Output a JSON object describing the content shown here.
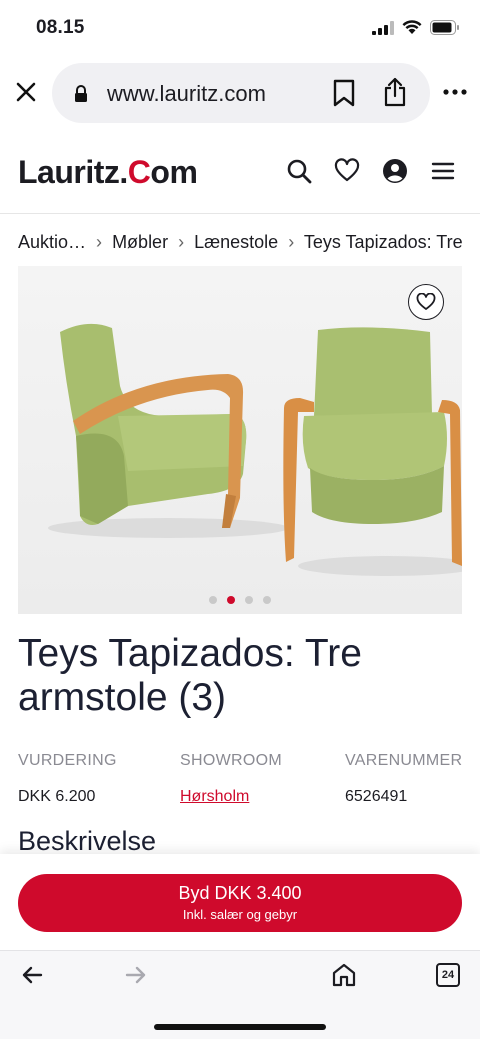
{
  "status": {
    "time": "08.15"
  },
  "browser": {
    "url": "www.lauritz.com",
    "icons": [
      "close-icon",
      "lock-icon",
      "bookmark-icon",
      "share-icon",
      "more-icon"
    ]
  },
  "header": {
    "logo_left": "Lauritz.",
    "logo_right": "om",
    "icons": [
      "search-icon",
      "heart-icon",
      "account-icon",
      "menu-icon"
    ]
  },
  "breadcrumb": [
    "Auktio…",
    "Møbler",
    "Lænestole",
    "Teys Tapizados: Tre"
  ],
  "gallery": {
    "image_count": 4,
    "active_index": 1
  },
  "item": {
    "title": "Teys Tapizados: Tre armstole (3)",
    "info": [
      {
        "label": "VURDERING",
        "value": "DKK 6.200"
      },
      {
        "label": "SHOWROOM",
        "value": "Hørsholm"
      },
      {
        "label": "VARENUMMER",
        "value": "6526491"
      }
    ],
    "section_heading": "Beskrivelse"
  },
  "bid": {
    "label": "Byd DKK 3.400",
    "sub_label": "Inkl. salær og gebyr"
  },
  "toolbar": {
    "tab_count": "24",
    "icons": [
      "back-arrow-icon",
      "forward-arrow-icon",
      "home-icon",
      "tabs-icon"
    ]
  },
  "colors": {
    "brand_red": "#cf0a2c",
    "text_dark": "#1c2032",
    "label_gray": "#8a8a92"
  }
}
